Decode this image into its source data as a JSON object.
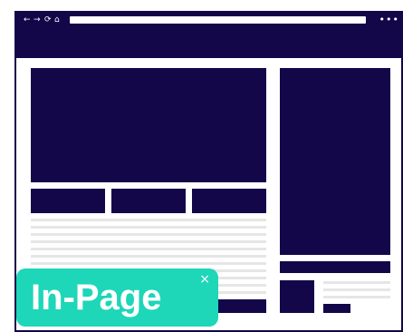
{
  "browser": {
    "back_icon": "←",
    "forward_icon": "→",
    "reload_icon": "⟳",
    "home_icon": "⌂",
    "menu_icon": "•••"
  },
  "badge": {
    "label": "In-Page",
    "close_icon": "×"
  },
  "colors": {
    "navy": "#13074a",
    "teal": "#1ed6b8",
    "line_gray": "#e6e6e6"
  }
}
